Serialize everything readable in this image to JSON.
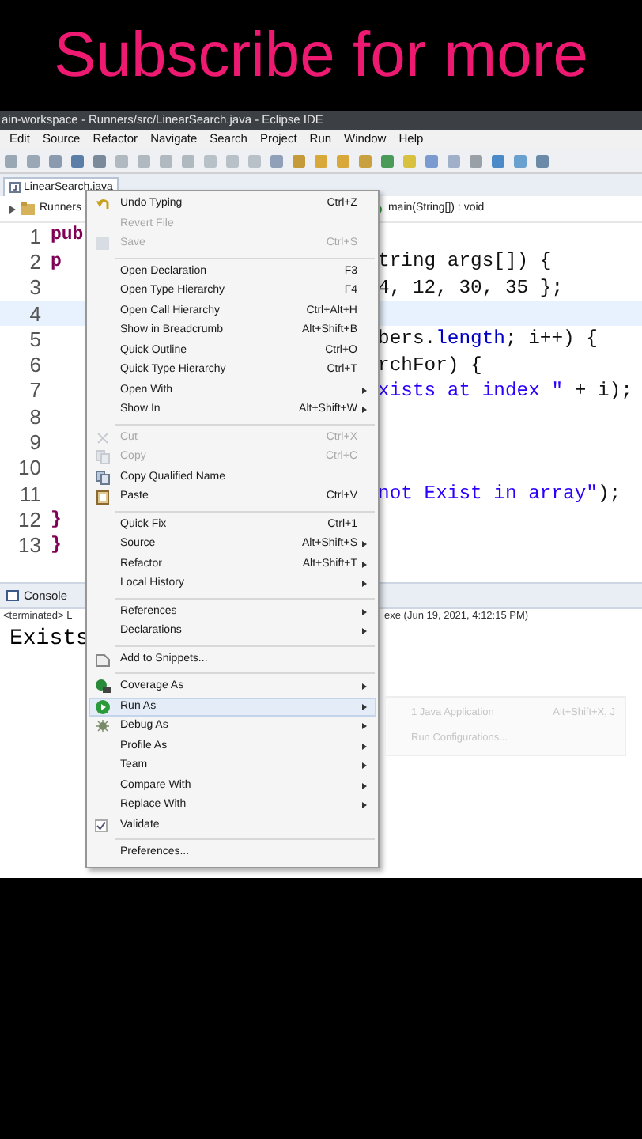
{
  "overlay_caption": "Subscribe for more",
  "window": {
    "title": "ain-workspace - Runners/src/LinearSearch.java - Eclipse IDE"
  },
  "menu_bar": [
    "Edit",
    "Source",
    "Refactor",
    "Navigate",
    "Search",
    "Project",
    "Run",
    "Window",
    "Help"
  ],
  "editor": {
    "tab": "LinearSearch.java",
    "breadcrumb_left": "Runners",
    "breadcrumb_right": "main(String[]) : void",
    "lines": [
      {
        "number": "1",
        "left": "pub"
      },
      {
        "number": "2",
        "left": "p",
        "right": [
          {
            "text": "tring args[]) {",
            "kind": "code"
          }
        ]
      },
      {
        "number": "3",
        "right": [
          {
            "text": "4, 12, 30, 35 };",
            "kind": "code"
          }
        ]
      },
      {
        "number": "4",
        "current": true
      },
      {
        "number": "5",
        "right": [
          {
            "text": "bers.",
            "kind": "code"
          },
          {
            "text": "length",
            "kind": "field"
          },
          {
            "text": "; i++) {",
            "kind": "code"
          }
        ]
      },
      {
        "number": "6",
        "right": [
          {
            "text": "rchFor) {",
            "kind": "code"
          }
        ]
      },
      {
        "number": "7",
        "right": [
          {
            "text": "xists at index \"",
            "kind": "string"
          },
          {
            "text": " + i);",
            "kind": "code"
          }
        ]
      },
      {
        "number": "8"
      },
      {
        "number": "9"
      },
      {
        "number": "10"
      },
      {
        "number": "11",
        "right": [
          {
            "text": "not Exist in array\"",
            "kind": "string"
          },
          {
            "text": ");",
            "kind": "code"
          }
        ]
      },
      {
        "number": "12",
        "left": "}"
      },
      {
        "number": "13",
        "left": "}"
      }
    ]
  },
  "console": {
    "tab": "Console",
    "status_left": "<terminated> L",
    "status_right": "exe (Jun 19, 2021, 4:12:15 PM)",
    "output": "Exists"
  },
  "context_menu": [
    [
      {
        "label": "Undo Typing",
        "shortcut": "Ctrl+Z",
        "disabled": false
      },
      {
        "label": "Revert File",
        "disabled": true
      },
      {
        "label": "Save",
        "shortcut": "Ctrl+S",
        "disabled": true
      }
    ],
    [
      {
        "label": "Open Declaration",
        "shortcut": "F3",
        "disabled": false
      },
      {
        "label": "Open Type Hierarchy",
        "shortcut": "F4",
        "disabled": false
      },
      {
        "label": "Open Call Hierarchy",
        "shortcut": "Ctrl+Alt+H",
        "disabled": false
      },
      {
        "label": "Show in Breadcrumb",
        "shortcut": "Alt+Shift+B",
        "disabled": false
      },
      {
        "label": "Quick Outline",
        "shortcut": "Ctrl+O",
        "disabled": false
      },
      {
        "label": "Quick Type Hierarchy",
        "shortcut": "Ctrl+T",
        "disabled": false
      },
      {
        "label": "Open With",
        "submenu": true,
        "disabled": false
      },
      {
        "label": "Show In",
        "shortcut": "Alt+Shift+W",
        "submenu": true,
        "disabled": false
      }
    ],
    [
      {
        "label": "Cut",
        "shortcut": "Ctrl+X",
        "disabled": true
      },
      {
        "label": "Copy",
        "shortcut": "Ctrl+C",
        "disabled": true
      },
      {
        "label": "Copy Qualified Name",
        "disabled": false
      },
      {
        "label": "Paste",
        "shortcut": "Ctrl+V",
        "disabled": false
      }
    ],
    [
      {
        "label": "Quick Fix",
        "shortcut": "Ctrl+1",
        "disabled": false
      },
      {
        "label": "Source",
        "shortcut": "Alt+Shift+S",
        "submenu": true,
        "disabled": false
      },
      {
        "label": "Refactor",
        "shortcut": "Alt+Shift+T",
        "submenu": true,
        "disabled": false
      },
      {
        "label": "Local History",
        "submenu": true,
        "disabled": false
      }
    ],
    [
      {
        "label": "References",
        "submenu": true,
        "disabled": false
      },
      {
        "label": "Declarations",
        "submenu": true,
        "disabled": false
      }
    ],
    [
      {
        "label": "Add to Snippets...",
        "disabled": false
      }
    ],
    [
      {
        "label": "Coverage As",
        "submenu": true,
        "disabled": false,
        "selected": false
      },
      {
        "label": "Run As",
        "submenu": true,
        "disabled": false,
        "selected": true
      },
      {
        "label": "Debug As",
        "submenu": true,
        "disabled": false,
        "selected": false
      },
      {
        "label": "Profile As",
        "submenu": true,
        "disabled": false,
        "selected": false
      },
      {
        "label": "Team",
        "submenu": true,
        "disabled": false,
        "selected": false
      },
      {
        "label": "Compare With",
        "submenu": true,
        "disabled": false,
        "selected": false
      },
      {
        "label": "Replace With",
        "submenu": true,
        "disabled": false,
        "selected": false
      },
      {
        "label": "Validate",
        "kind": "checkbox",
        "checked": true,
        "disabled": false,
        "selected": false
      }
    ],
    [
      {
        "label": "Preferences...",
        "disabled": false
      }
    ]
  ],
  "submenu": [
    {
      "label": "1 Java Application",
      "shortcut": "Alt+Shift+X, J"
    },
    {
      "label": "Run Configurations..."
    }
  ]
}
